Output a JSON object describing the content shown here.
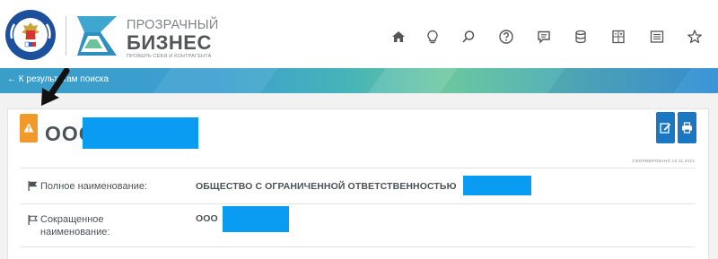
{
  "header": {
    "brand_line1": "ПРОЗРАЧНЫЙ",
    "brand_line2": "БИЗНЕС",
    "brand_line3": "ПРОВЕРЬ СЕБЯ И КОНТРАГЕНТА",
    "nav_icons": [
      "home-icon",
      "lightbulb-icon",
      "search-icon",
      "help-icon",
      "chat-icon",
      "database-icon",
      "calculator-icon",
      "list-icon",
      "star-icon"
    ]
  },
  "nav": {
    "back_label": "← К результатам поиска"
  },
  "company": {
    "short_name_prefix": "ООО",
    "formed_note": "СФОРМИРОВАНО 10.11.2022",
    "rows": [
      {
        "label": "Полное наименование:",
        "value": "ОБЩЕСТВО С ОГРАНИЧЕННОЙ ОТВЕТСТВЕННОСТЬЮ"
      },
      {
        "label": "Сокращенное наименование:",
        "label_line1": "Сокращенное",
        "label_line2": "наименование:",
        "value": "ООО"
      }
    ]
  },
  "colors": {
    "warning": "#f19a2a",
    "action_button": "#1a78c2",
    "redaction": "#0a9cf2",
    "band_left": "#3a9ec9",
    "band_mid": "#6ac79f",
    "band_right": "#3b94d8"
  }
}
